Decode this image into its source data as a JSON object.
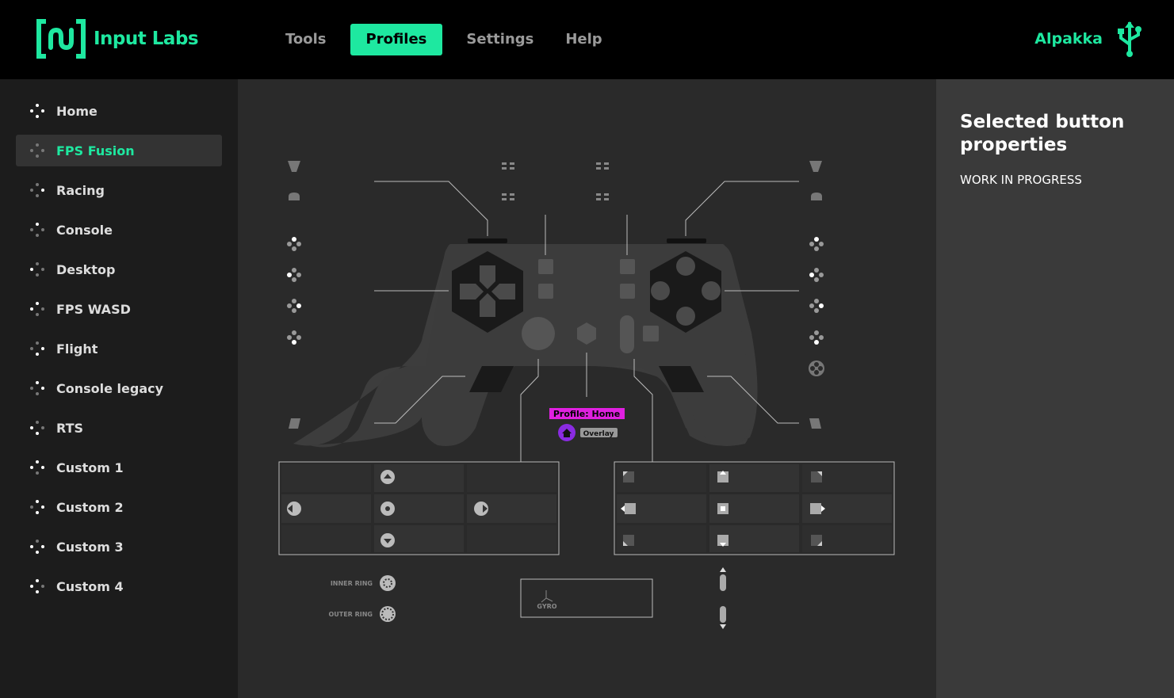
{
  "app": {
    "brand": "Input Labs",
    "device_name": "Alpakka",
    "accent_color": "#1ee8a0"
  },
  "nav": {
    "items": [
      {
        "label": "Tools",
        "active": false
      },
      {
        "label": "Profiles",
        "active": true
      },
      {
        "label": "Settings",
        "active": false
      },
      {
        "label": "Help",
        "active": false
      }
    ]
  },
  "sidebar": {
    "items": [
      {
        "label": "Home",
        "active": false
      },
      {
        "label": "FPS Fusion",
        "active": true
      },
      {
        "label": "Racing",
        "active": false
      },
      {
        "label": "Console",
        "active": false
      },
      {
        "label": "Desktop",
        "active": false
      },
      {
        "label": "FPS WASD",
        "active": false
      },
      {
        "label": "Flight",
        "active": false
      },
      {
        "label": "Console legacy",
        "active": false
      },
      {
        "label": "RTS",
        "active": false
      },
      {
        "label": "Custom 1",
        "active": false
      },
      {
        "label": "Custom 2",
        "active": false
      },
      {
        "label": "Custom 3",
        "active": false
      },
      {
        "label": "Custom 4",
        "active": false
      }
    ]
  },
  "diagram": {
    "profile_label": "Profile: Home",
    "overlay_label": "Overlay",
    "inner_ring_label": "INNER RING",
    "outer_ring_label": "OUTER RING",
    "gyro_label": "GYRO",
    "profile_badge_color": "#e020e0",
    "home_icon_color": "#8a2be2"
  },
  "panel": {
    "title": "Selected button properties",
    "status": "WORK IN PROGRESS"
  }
}
